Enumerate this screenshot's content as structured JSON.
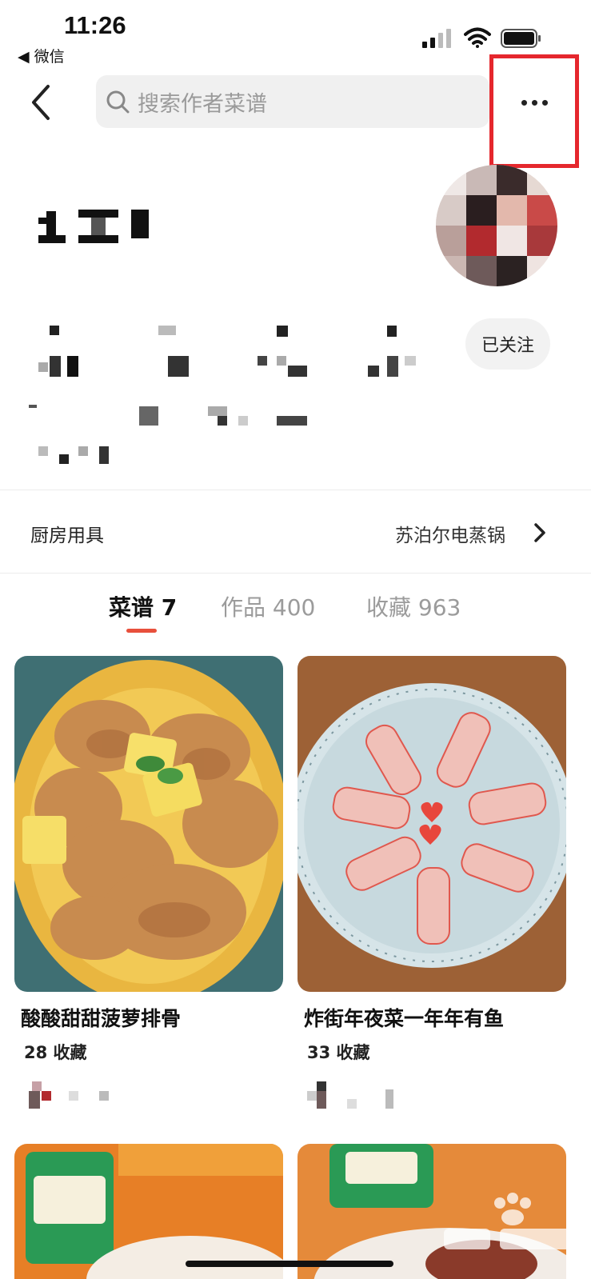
{
  "status_bar": {
    "time": "11:26",
    "back_app": "◀ 微信"
  },
  "search": {
    "placeholder": "搜索作者菜谱"
  },
  "profile": {
    "follow_label": "已关注"
  },
  "kitchen": {
    "label": "厨房用具",
    "value": "苏泊尔电蒸锅"
  },
  "tabs": [
    {
      "label": "菜谱 7",
      "active": true
    },
    {
      "label": "作品 400",
      "active": false
    },
    {
      "label": "收藏 963",
      "active": false
    }
  ],
  "recipes": [
    {
      "title": "酸酸甜甜菠萝排骨",
      "favorites": "28 收藏"
    },
    {
      "title": "炸街年夜菜一年年有鱼",
      "favorites": "33 收藏"
    }
  ],
  "colors": {
    "accent": "#e8503c",
    "highlight_box": "#e5272d"
  }
}
